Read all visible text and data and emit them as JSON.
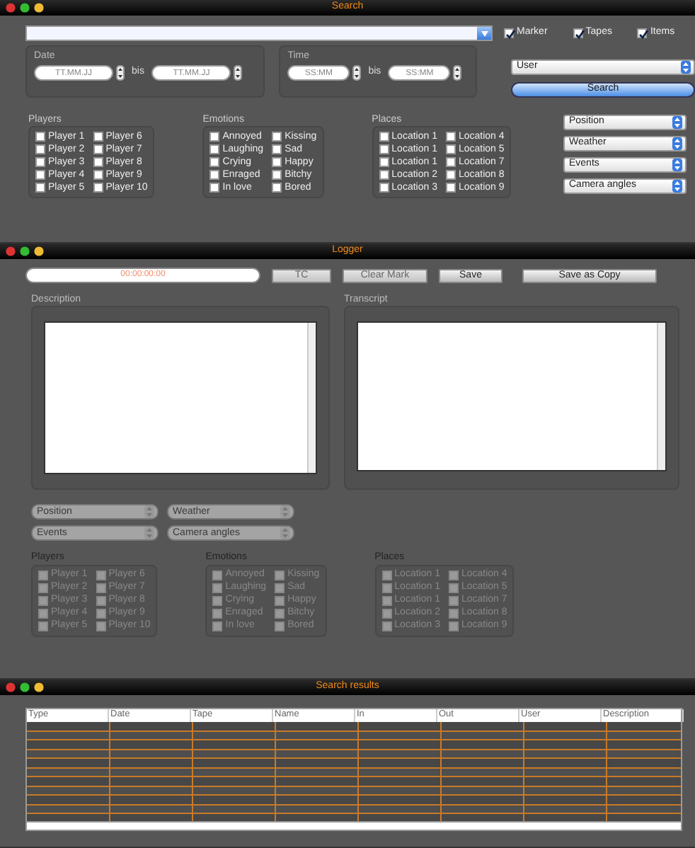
{
  "search_window": {
    "title": "Search",
    "filters": [
      {
        "label": "Marker",
        "checked": true
      },
      {
        "label": "Tapes",
        "checked": true
      },
      {
        "label": "Items",
        "checked": true
      }
    ],
    "date": {
      "label": "Date",
      "from": {
        "placeholder": "TT.MM.JJ"
      },
      "separator": "bis",
      "to": {
        "placeholder": "TT.MM.JJ"
      }
    },
    "time": {
      "label": "Time",
      "from": {
        "placeholder": "SS:MM"
      },
      "separator": "bis",
      "to": {
        "placeholder": "SS:MM"
      }
    },
    "user_select": "User",
    "search_button": "Search",
    "groups": [
      {
        "label": "Players",
        "disabled": false,
        "items": [
          {
            "label": "Player 1",
            "checked": false
          },
          {
            "label": "Player 2",
            "checked": false
          },
          {
            "label": "Player 3",
            "checked": false
          },
          {
            "label": "Player 4",
            "checked": false
          },
          {
            "label": "Player 5",
            "checked": false
          },
          {
            "label": "Player 6",
            "checked": false
          },
          {
            "label": "Player 7",
            "checked": false
          },
          {
            "label": "Player 8",
            "checked": false
          },
          {
            "label": "Player 9",
            "checked": false
          },
          {
            "label": "Player 10",
            "checked": false
          }
        ]
      },
      {
        "label": "Emotions",
        "disabled": false,
        "items": [
          {
            "label": "Annoyed",
            "checked": false
          },
          {
            "label": "Laughing",
            "checked": false
          },
          {
            "label": "Crying",
            "checked": false
          },
          {
            "label": "Enraged",
            "checked": false
          },
          {
            "label": "In love",
            "checked": false
          },
          {
            "label": "Kissing",
            "checked": false
          },
          {
            "label": "Sad",
            "checked": false
          },
          {
            "label": "Happy",
            "checked": false
          },
          {
            "label": "Bitchy",
            "checked": false
          },
          {
            "label": "Bored",
            "checked": false
          }
        ]
      },
      {
        "label": "Places",
        "disabled": false,
        "items": [
          {
            "label": "Location 1",
            "checked": false
          },
          {
            "label": "Location 1",
            "checked": false
          },
          {
            "label": "Location 1",
            "checked": false
          },
          {
            "label": "Location 2",
            "checked": false
          },
          {
            "label": "Location 3",
            "checked": false
          },
          {
            "label": "Location 4",
            "checked": false
          },
          {
            "label": "Location 5",
            "checked": false
          },
          {
            "label": "Location 7",
            "checked": false
          },
          {
            "label": "Location 8",
            "checked": false
          },
          {
            "label": "Location 9",
            "checked": false
          }
        ]
      }
    ],
    "dropdowns": [
      {
        "label": "Position",
        "disabled": false
      },
      {
        "label": "Weather",
        "disabled": false
      },
      {
        "label": "Events",
        "disabled": false
      },
      {
        "label": "Camera angles",
        "disabled": false
      }
    ]
  },
  "logger": {
    "title": "Logger",
    "timecode": "00:00:00:00",
    "buttons": [
      {
        "label": "TC",
        "disabled": true
      },
      {
        "label": "Clear Mark",
        "disabled": true
      },
      {
        "label": "Save",
        "disabled": false
      },
      {
        "label": "Save as Copy",
        "disabled": false
      }
    ],
    "description_label": "Description",
    "transcript_label": "Transcript",
    "dropdowns": [
      {
        "label": "Position",
        "disabled": true
      },
      {
        "label": "Weather",
        "disabled": true
      },
      {
        "label": "Events",
        "disabled": true
      },
      {
        "label": "Camera angles",
        "disabled": true
      }
    ],
    "groups": [
      {
        "label": "Players",
        "disabled": true,
        "items": [
          {
            "label": "Player 1",
            "checked": false
          },
          {
            "label": "Player 2",
            "checked": false
          },
          {
            "label": "Player 3",
            "checked": false
          },
          {
            "label": "Player 4",
            "checked": false
          },
          {
            "label": "Player 5",
            "checked": false
          },
          {
            "label": "Player 6",
            "checked": false
          },
          {
            "label": "Player 7",
            "checked": false
          },
          {
            "label": "Player 8",
            "checked": false
          },
          {
            "label": "Player 9",
            "checked": false
          },
          {
            "label": "Player 10",
            "checked": false
          }
        ]
      },
      {
        "label": "Emotions",
        "disabled": true,
        "items": [
          {
            "label": "Annoyed",
            "checked": false
          },
          {
            "label": "Laughing",
            "checked": false
          },
          {
            "label": "Crying",
            "checked": false
          },
          {
            "label": "Enraged",
            "checked": false
          },
          {
            "label": "In love",
            "checked": false
          },
          {
            "label": "Kissing",
            "checked": false
          },
          {
            "label": "Sad",
            "checked": false
          },
          {
            "label": "Happy",
            "checked": false
          },
          {
            "label": "Bitchy",
            "checked": false
          },
          {
            "label": "Bored",
            "checked": false
          }
        ]
      },
      {
        "label": "Places",
        "disabled": true,
        "items": [
          {
            "label": "Location 1",
            "checked": false
          },
          {
            "label": "Location 1",
            "checked": false
          },
          {
            "label": "Location 1",
            "checked": false
          },
          {
            "label": "Location 2",
            "checked": false
          },
          {
            "label": "Location 3",
            "checked": false
          },
          {
            "label": "Location 4",
            "checked": false
          },
          {
            "label": "Location 5",
            "checked": false
          },
          {
            "label": "Location 7",
            "checked": false
          },
          {
            "label": "Location 8",
            "checked": false
          },
          {
            "label": "Location 9",
            "checked": false
          }
        ]
      }
    ]
  },
  "results": {
    "title": "Search results",
    "columns": [
      "Type",
      "Date",
      "Tape",
      "Name",
      "In",
      "Out",
      "User",
      "Description"
    ]
  }
}
